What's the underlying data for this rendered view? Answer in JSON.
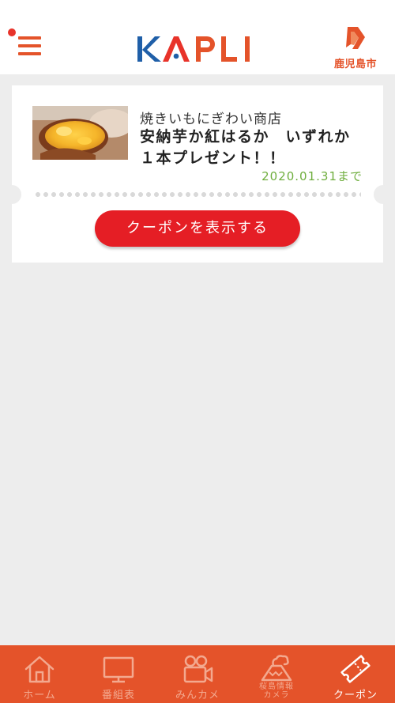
{
  "header": {
    "app_logo": "KAPLI",
    "city": "鹿児島市",
    "menu_icon": "hamburger-menu-icon",
    "has_notification": true
  },
  "coupon": {
    "shop": "焼きいもにぎわい商店",
    "title": "安納芋か紅はるか　いずれか\n１本プレゼント！！",
    "expiry": "2020.01.31まで",
    "button_label": "クーポンを表示する",
    "image": "roasted-sweet-potato-photo"
  },
  "nav": {
    "items": [
      {
        "label": "ホーム",
        "icon": "home-icon"
      },
      {
        "label": "番組表",
        "icon": "tv-icon"
      },
      {
        "label": "みんカメ",
        "icon": "video-camera-icon"
      },
      {
        "label": "桜島情報\nカメラ",
        "icon": "volcano-icon"
      },
      {
        "label": "クーポン",
        "icon": "ticket-icon",
        "active": true
      }
    ]
  },
  "colors": {
    "brand_orange": "#e4532a",
    "button_red": "#e51e25",
    "expiry_green": "#6fae3e",
    "logo_blue": "#1f5fa8"
  }
}
